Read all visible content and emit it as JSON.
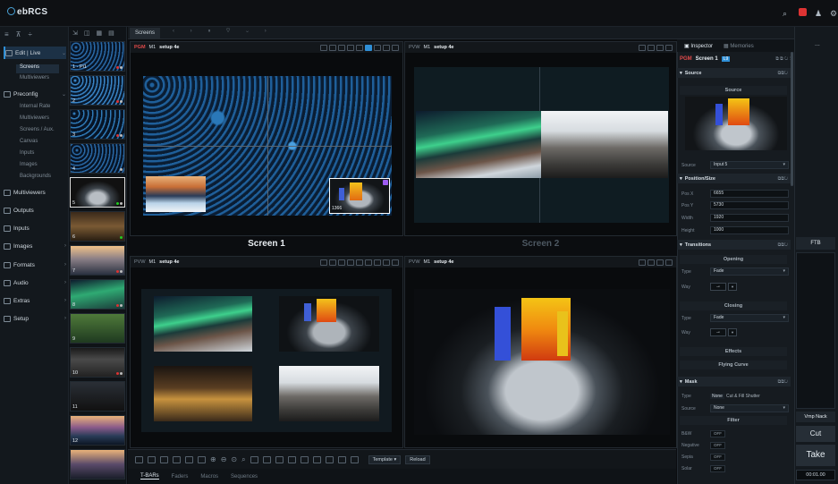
{
  "app": {
    "name": "ebRCS"
  },
  "topbar": {
    "icons": [
      "search-icon",
      "alert-icon",
      "user-icon",
      "settings-icon"
    ],
    "alert_badge": "1"
  },
  "leftnav": {
    "sections": [
      {
        "label": "Edit | Live",
        "active": true,
        "subitems": [
          {
            "label": "Screens",
            "active": true
          },
          {
            "label": "Multiviewers",
            "active": false
          }
        ]
      },
      {
        "label": "Preconfig",
        "active": false,
        "subitems": [
          {
            "label": "Internal Rate"
          },
          {
            "label": "Multiviewers"
          },
          {
            "label": "Screens / Aux."
          },
          {
            "label": "Canvas"
          },
          {
            "label": "Inputs"
          },
          {
            "label": "Images"
          },
          {
            "label": "Backgrounds"
          }
        ]
      },
      {
        "label": "Multiviewers"
      },
      {
        "label": "Outputs"
      },
      {
        "label": "Inputs"
      },
      {
        "label": "Images"
      },
      {
        "label": "Formats"
      },
      {
        "label": "Audio"
      },
      {
        "label": "Extras"
      },
      {
        "label": "Setup"
      }
    ]
  },
  "thumbs": [
    {
      "num": "1 - Pi1",
      "dots": [
        "#d33",
        "#bbb"
      ]
    },
    {
      "num": "2",
      "dots": [
        "#d33",
        "#bbb"
      ]
    },
    {
      "num": "3",
      "dots": [
        "#d33",
        "#bbb"
      ]
    },
    {
      "num": "4",
      "dots": [
        "#bbb"
      ]
    },
    {
      "num": "5",
      "dots": [
        "#2c2",
        "#bbb"
      ]
    },
    {
      "num": "6",
      "dots": [
        "#2c2"
      ]
    },
    {
      "num": "7",
      "dots": [
        "#d33",
        "#bbb"
      ]
    },
    {
      "num": "8",
      "dots": [
        "#d33",
        "#bbb"
      ]
    },
    {
      "num": "9",
      "dots": []
    },
    {
      "num": "10",
      "dots": [
        "#d33",
        "#bbb"
      ]
    },
    {
      "num": "11",
      "dots": []
    },
    {
      "num": "12",
      "dots": []
    },
    {
      "num": "",
      "dots": []
    }
  ],
  "tabs": {
    "screens": "Screens"
  },
  "quads": {
    "tl": {
      "mode": "PGM",
      "m": "M1",
      "name": "setup 4e"
    },
    "tr": {
      "mode": "PVW",
      "m": "M1",
      "name": "setup 4e"
    },
    "bl": {
      "mode": "PVW",
      "m": "M1",
      "name": "setup 4e"
    },
    "br": {
      "mode": "PVW",
      "m": "M1",
      "name": "setup 4e"
    }
  },
  "screens": {
    "screen1": "Screen 1",
    "screen2": "Screen 2"
  },
  "layer_badge": "1366",
  "bottom": {
    "template": "Template",
    "reload": "Reload",
    "tabs": [
      "T-BARs",
      "Faders",
      "Macros",
      "Sequences"
    ]
  },
  "inspector": {
    "tabs": [
      "Inspector",
      "Memories"
    ],
    "header_mode": "PGM",
    "header_name": "Screen 1",
    "header_badge": "L9",
    "source_section": "Source",
    "source_sub": "Source",
    "source_label": "Source",
    "source_value": "Input 5",
    "possize_section": "Position/Size",
    "posx_label": "Pos X",
    "posx": "6655",
    "posy_label": "Pos Y",
    "posy": "5730",
    "width_label": "Width",
    "width": "1920",
    "height_label": "Height",
    "height": "1000",
    "transitions_section": "Transitions",
    "opening": "Opening",
    "type_label": "Type",
    "open_type": "Fade",
    "way_label": "Way",
    "way_glyph": "→",
    "closing": "Closing",
    "close_type": "Fade",
    "effects": "Effects",
    "flying": "Flying Curve",
    "mask_section": "Mask",
    "mask_type_label": "Type",
    "mask_type_none": "None",
    "mask_type_opts": "Cut & Fill  Shutter",
    "mask_source_label": "Source",
    "mask_source": "None",
    "filter": "Filter",
    "filters": [
      {
        "label": "B&W",
        "value": "OFF"
      },
      {
        "label": "Negative",
        "value": "OFF"
      },
      {
        "label": "Sepia",
        "value": "OFF"
      },
      {
        "label": "Solar",
        "value": "OFF"
      }
    ]
  },
  "right": {
    "ftb": "FTB",
    "vmp_nack": "Vmp Nack",
    "cut": "Cut",
    "take": "Take",
    "duration": "00:01.00",
    "more": "..."
  }
}
